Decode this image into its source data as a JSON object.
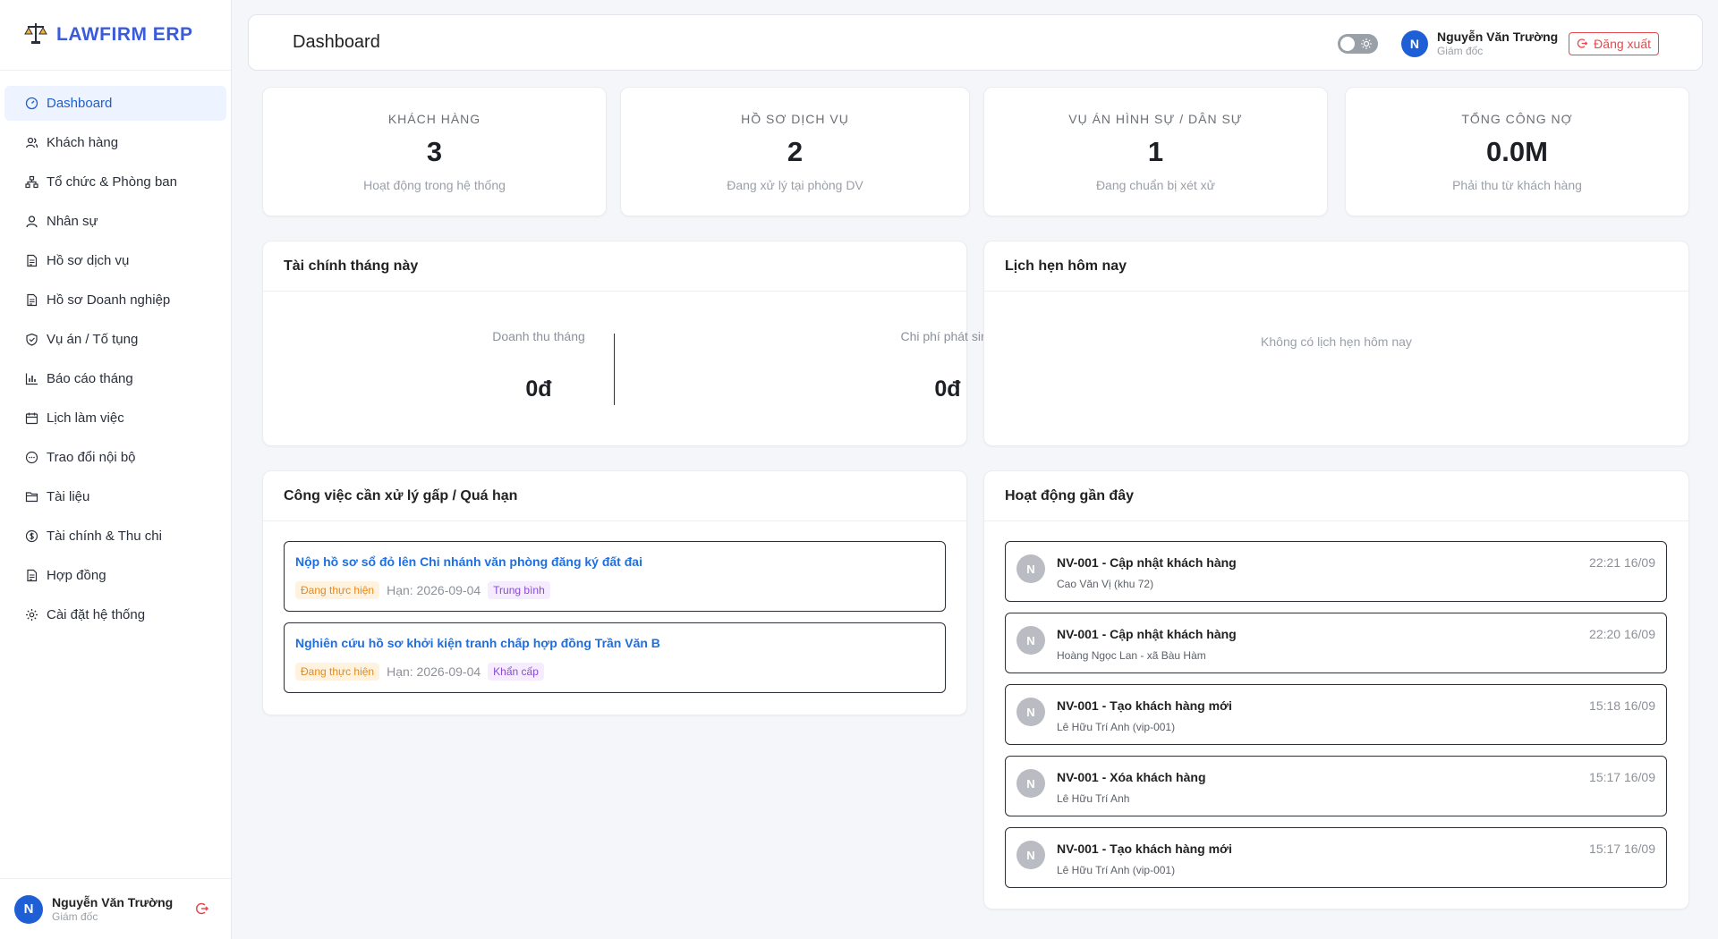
{
  "brand": {
    "name": "LAWFIRM ERP"
  },
  "sidebar": {
    "items": [
      {
        "label": "Dashboard",
        "icon": "dashboard-icon",
        "active": true
      },
      {
        "label": "Khách hàng",
        "icon": "users-icon"
      },
      {
        "label": "Tổ chức & Phòng ban",
        "icon": "org-chart-icon"
      },
      {
        "label": "Nhân sự",
        "icon": "user-icon"
      },
      {
        "label": "Hồ sơ dịch vụ",
        "icon": "file-icon"
      },
      {
        "label": "Hồ sơ Doanh nghiệp",
        "icon": "file-icon"
      },
      {
        "label": "Vụ án / Tố tụng",
        "icon": "shield-icon"
      },
      {
        "label": "Báo cáo tháng",
        "icon": "bar-chart-icon"
      },
      {
        "label": "Lịch làm việc",
        "icon": "calendar-icon"
      },
      {
        "label": "Trao đổi nội bộ",
        "icon": "chat-icon"
      },
      {
        "label": "Tài liệu",
        "icon": "folder-icon"
      },
      {
        "label": "Tài chính & Thu chi",
        "icon": "dollar-icon"
      },
      {
        "label": "Hợp đồng",
        "icon": "file-icon"
      },
      {
        "label": "Cài đặt hệ thống",
        "icon": "gear-icon"
      }
    ],
    "user": {
      "initial": "N",
      "name": "Nguyễn Văn Trường",
      "role": "Giám đốc"
    }
  },
  "header": {
    "title": "Dashboard",
    "user": {
      "initial": "N",
      "name": "Nguyễn Văn Trường",
      "role": "Giám đốc"
    },
    "logout_label": "Đăng xuất"
  },
  "stats": [
    {
      "label": "KHÁCH HÀNG",
      "value": "3",
      "sub": "Hoạt động trong hệ thống"
    },
    {
      "label": "HỒ SƠ DỊCH VỤ",
      "value": "2",
      "sub": "Đang xử lý tại phòng DV"
    },
    {
      "label": "VỤ ÁN HÌNH SỰ / DÂN SỰ",
      "value": "1",
      "sub": "Đang chuẩn bị xét xử"
    },
    {
      "label": "TỔNG CÔNG NỢ",
      "value": "0.0M",
      "sub": "Phải thu từ khách hàng"
    }
  ],
  "finance": {
    "title": "Tài chính tháng này",
    "revenue_label": "Doanh thu tháng",
    "revenue_value": "0đ",
    "expense_label": "Chi phí phát sinh",
    "expense_value": "0đ"
  },
  "appointments": {
    "title": "Lịch hẹn hôm nay",
    "empty": "Không có lịch hẹn hôm nay"
  },
  "tasks": {
    "title": "Công việc cần xử lý gấp / Quá hạn",
    "items": [
      {
        "title": "Nộp hồ sơ sổ đỏ lên Chi nhánh văn phòng đăng ký đất đai",
        "status": "Đang thực hiện",
        "deadline": "Hạn: 2026-09-04",
        "priority": "Trung bình"
      },
      {
        "title": "Nghiên cứu hồ sơ khởi kiện tranh chấp hợp đồng Trần Văn B",
        "status": "Đang thực hiện",
        "deadline": "Hạn: 2026-09-04",
        "priority": "Khẩn cấp"
      }
    ]
  },
  "activity": {
    "title": "Hoạt động gần đây",
    "items": [
      {
        "initial": "N",
        "title": "NV-001 - Cập nhật khách hàng",
        "sub": "Cao Văn Vị (khu 72)",
        "time": "22:21 16/09"
      },
      {
        "initial": "N",
        "title": "NV-001 - Cập nhật khách hàng",
        "sub": "Hoàng Ngọc Lan - xã Bàu Hàm",
        "time": "22:20 16/09"
      },
      {
        "initial": "N",
        "title": "NV-001 - Tạo khách hàng mới",
        "sub": "Lê Hữu Trí Anh (vip-001)",
        "time": "15:18 16/09"
      },
      {
        "initial": "N",
        "title": "NV-001 - Xóa khách hàng",
        "sub": "Lê Hữu Trí Anh",
        "time": "15:17 16/09"
      },
      {
        "initial": "N",
        "title": "NV-001 - Tạo khách hàng mới",
        "sub": "Lê Hữu Trí Anh (vip-001)",
        "time": "15:17 16/09"
      }
    ]
  },
  "colors": {
    "accent": "#1f5fd6",
    "brand": "#3b5bdb",
    "danger": "#e5484d",
    "link": "#1f6fe0"
  }
}
